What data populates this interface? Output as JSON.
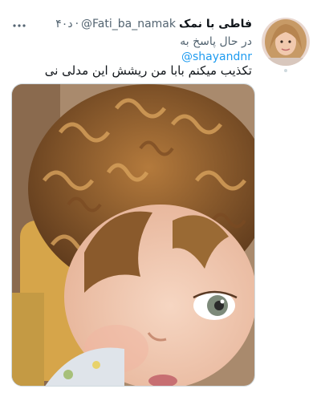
{
  "tweet": {
    "display_name": "فاطی با نمک",
    "handle": "@Fati_ba_namak",
    "separator": "·",
    "time": "۴۰د",
    "replying_to_label": "در حال پاسخ به",
    "mention": "@shayandnr",
    "text": "تکذیب میکنم بابا من ریشش این مدلی نی"
  },
  "icons": {
    "more": "more-dots-icon",
    "avatar": "user-avatar"
  },
  "colors": {
    "link": "#1d9bf0",
    "secondary_text": "#536471",
    "primary_text": "#0f1419"
  }
}
